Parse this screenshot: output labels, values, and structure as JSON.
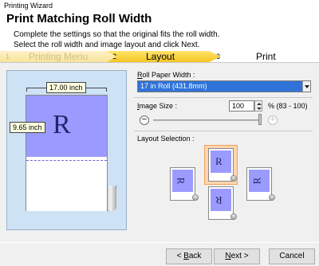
{
  "window": {
    "title": "Printing Wizard"
  },
  "header": {
    "title": "Print Matching Roll Width",
    "line1": "Complete the settings so that the original fits the roll width.",
    "line2": "Select the roll width and image layout and click Next."
  },
  "steps": [
    {
      "num": "1",
      "label": "Printing Menu",
      "state": "done"
    },
    {
      "num": "2",
      "label": "Layout",
      "state": "current"
    },
    {
      "num": "3",
      "label": "Print",
      "state": "upcoming"
    }
  ],
  "preview": {
    "width_label": "17.00 inch",
    "height_label": "9.65 inch",
    "glyph": "R",
    "colors": {
      "print_area": "#9b9bff",
      "background": "#cde2f4"
    }
  },
  "roll_paper": {
    "label": "Roll Paper Width :",
    "label_accel": "R",
    "label_rest": "oll Paper Width :",
    "value": "17 in Roll (431.8mm)"
  },
  "image_size": {
    "label_accel": "I",
    "label_rest": "mage Size :",
    "value": "100",
    "range": "% (83 - 100)",
    "slider_level": 1.0,
    "minus_icon": "−",
    "plus_icon": "+"
  },
  "layout_selection": {
    "label": "Layout Selection :",
    "options": [
      {
        "glyph": "R",
        "rotation": "0",
        "selected": true
      },
      {
        "glyph": "R",
        "rotation": "90",
        "selected": false
      },
      {
        "glyph": "R",
        "rotation": "270",
        "selected": false
      },
      {
        "glyph": "R",
        "rotation": "180",
        "selected": false
      }
    ]
  },
  "footer": {
    "back_accel": "B",
    "back": "< Back",
    "back_rest": "ack",
    "next_accel": "N",
    "next_rest": "ext >",
    "cancel": "Cancel"
  }
}
